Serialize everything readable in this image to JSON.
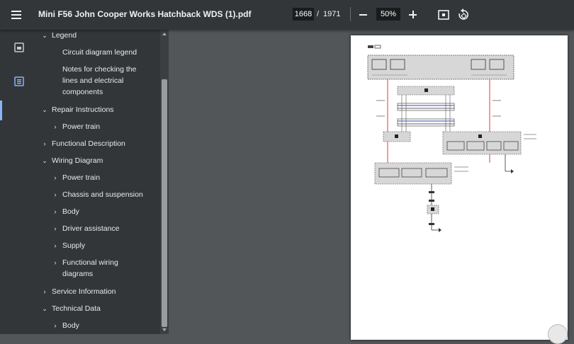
{
  "toolbar": {
    "title": "Mini F56 John Cooper Works Hatchback WDS (1).pdf",
    "page_current": "1668",
    "page_separator": "/",
    "page_total": "1971",
    "zoom": "50%"
  },
  "outline": {
    "items": [
      {
        "label": "Legend"
      },
      {
        "label": "Circuit diagram legend"
      },
      {
        "label": "Notes for checking the"
      },
      {
        "label": "lines and electrical"
      },
      {
        "label": "components"
      },
      {
        "label": "Repair Instructions"
      },
      {
        "label": "Power train"
      },
      {
        "label": "Functional Description"
      },
      {
        "label": "Wiring Diagram"
      },
      {
        "label": "Power train"
      },
      {
        "label": "Chassis and suspension"
      },
      {
        "label": "Body"
      },
      {
        "label": "Driver assistance"
      },
      {
        "label": "Supply"
      },
      {
        "label": "Functional wiring"
      },
      {
        "label": "diagrams"
      },
      {
        "label": "Service Information"
      },
      {
        "label": "Technical Data"
      },
      {
        "label": "Body"
      }
    ]
  },
  "colors": {
    "toolbar_bg": "#323639",
    "viewer_bg": "#525659",
    "accent": "#8ab4f8",
    "wire_red": "#e53935",
    "wire_blue": "#3949ab"
  },
  "icons": [
    "menu-icon",
    "thumbnail-icon",
    "outline-icon",
    "zoom-out-icon",
    "zoom-in-icon",
    "fit-page-icon",
    "rotate-icon",
    "chevron-down-icon",
    "chevron-right-icon"
  ]
}
